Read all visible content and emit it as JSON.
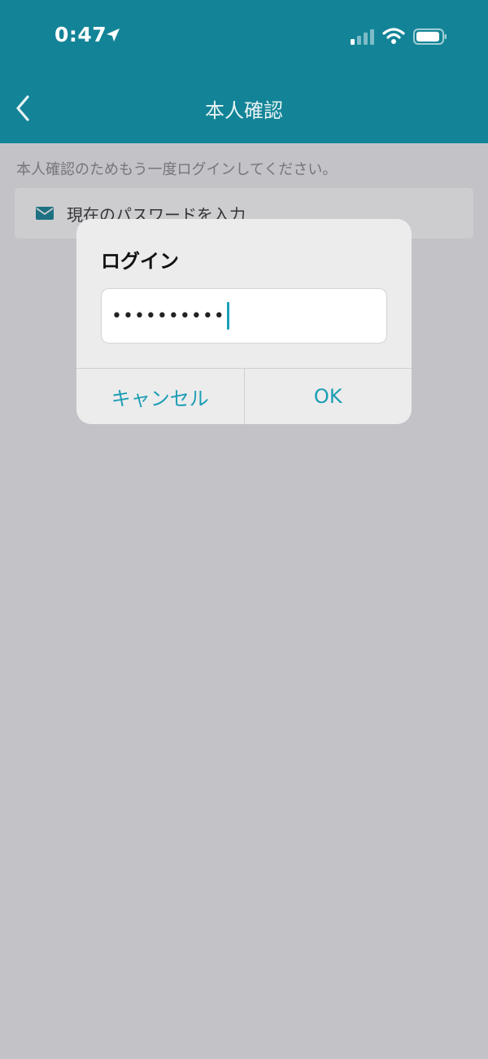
{
  "status_bar": {
    "time": "0:47"
  },
  "nav": {
    "title": "本人確認",
    "back_icon": "chevron-left-icon"
  },
  "content": {
    "instruction": "本人確認のためもう一度ログインしてください。",
    "password_field_label": "現在のパスワードを入力"
  },
  "dialog": {
    "title": "ログイン",
    "password_value": "••••••••••",
    "cancel_label": "キャンセル",
    "ok_label": "OK"
  },
  "colors": {
    "header": "#138497",
    "accent": "#1b9db4"
  }
}
